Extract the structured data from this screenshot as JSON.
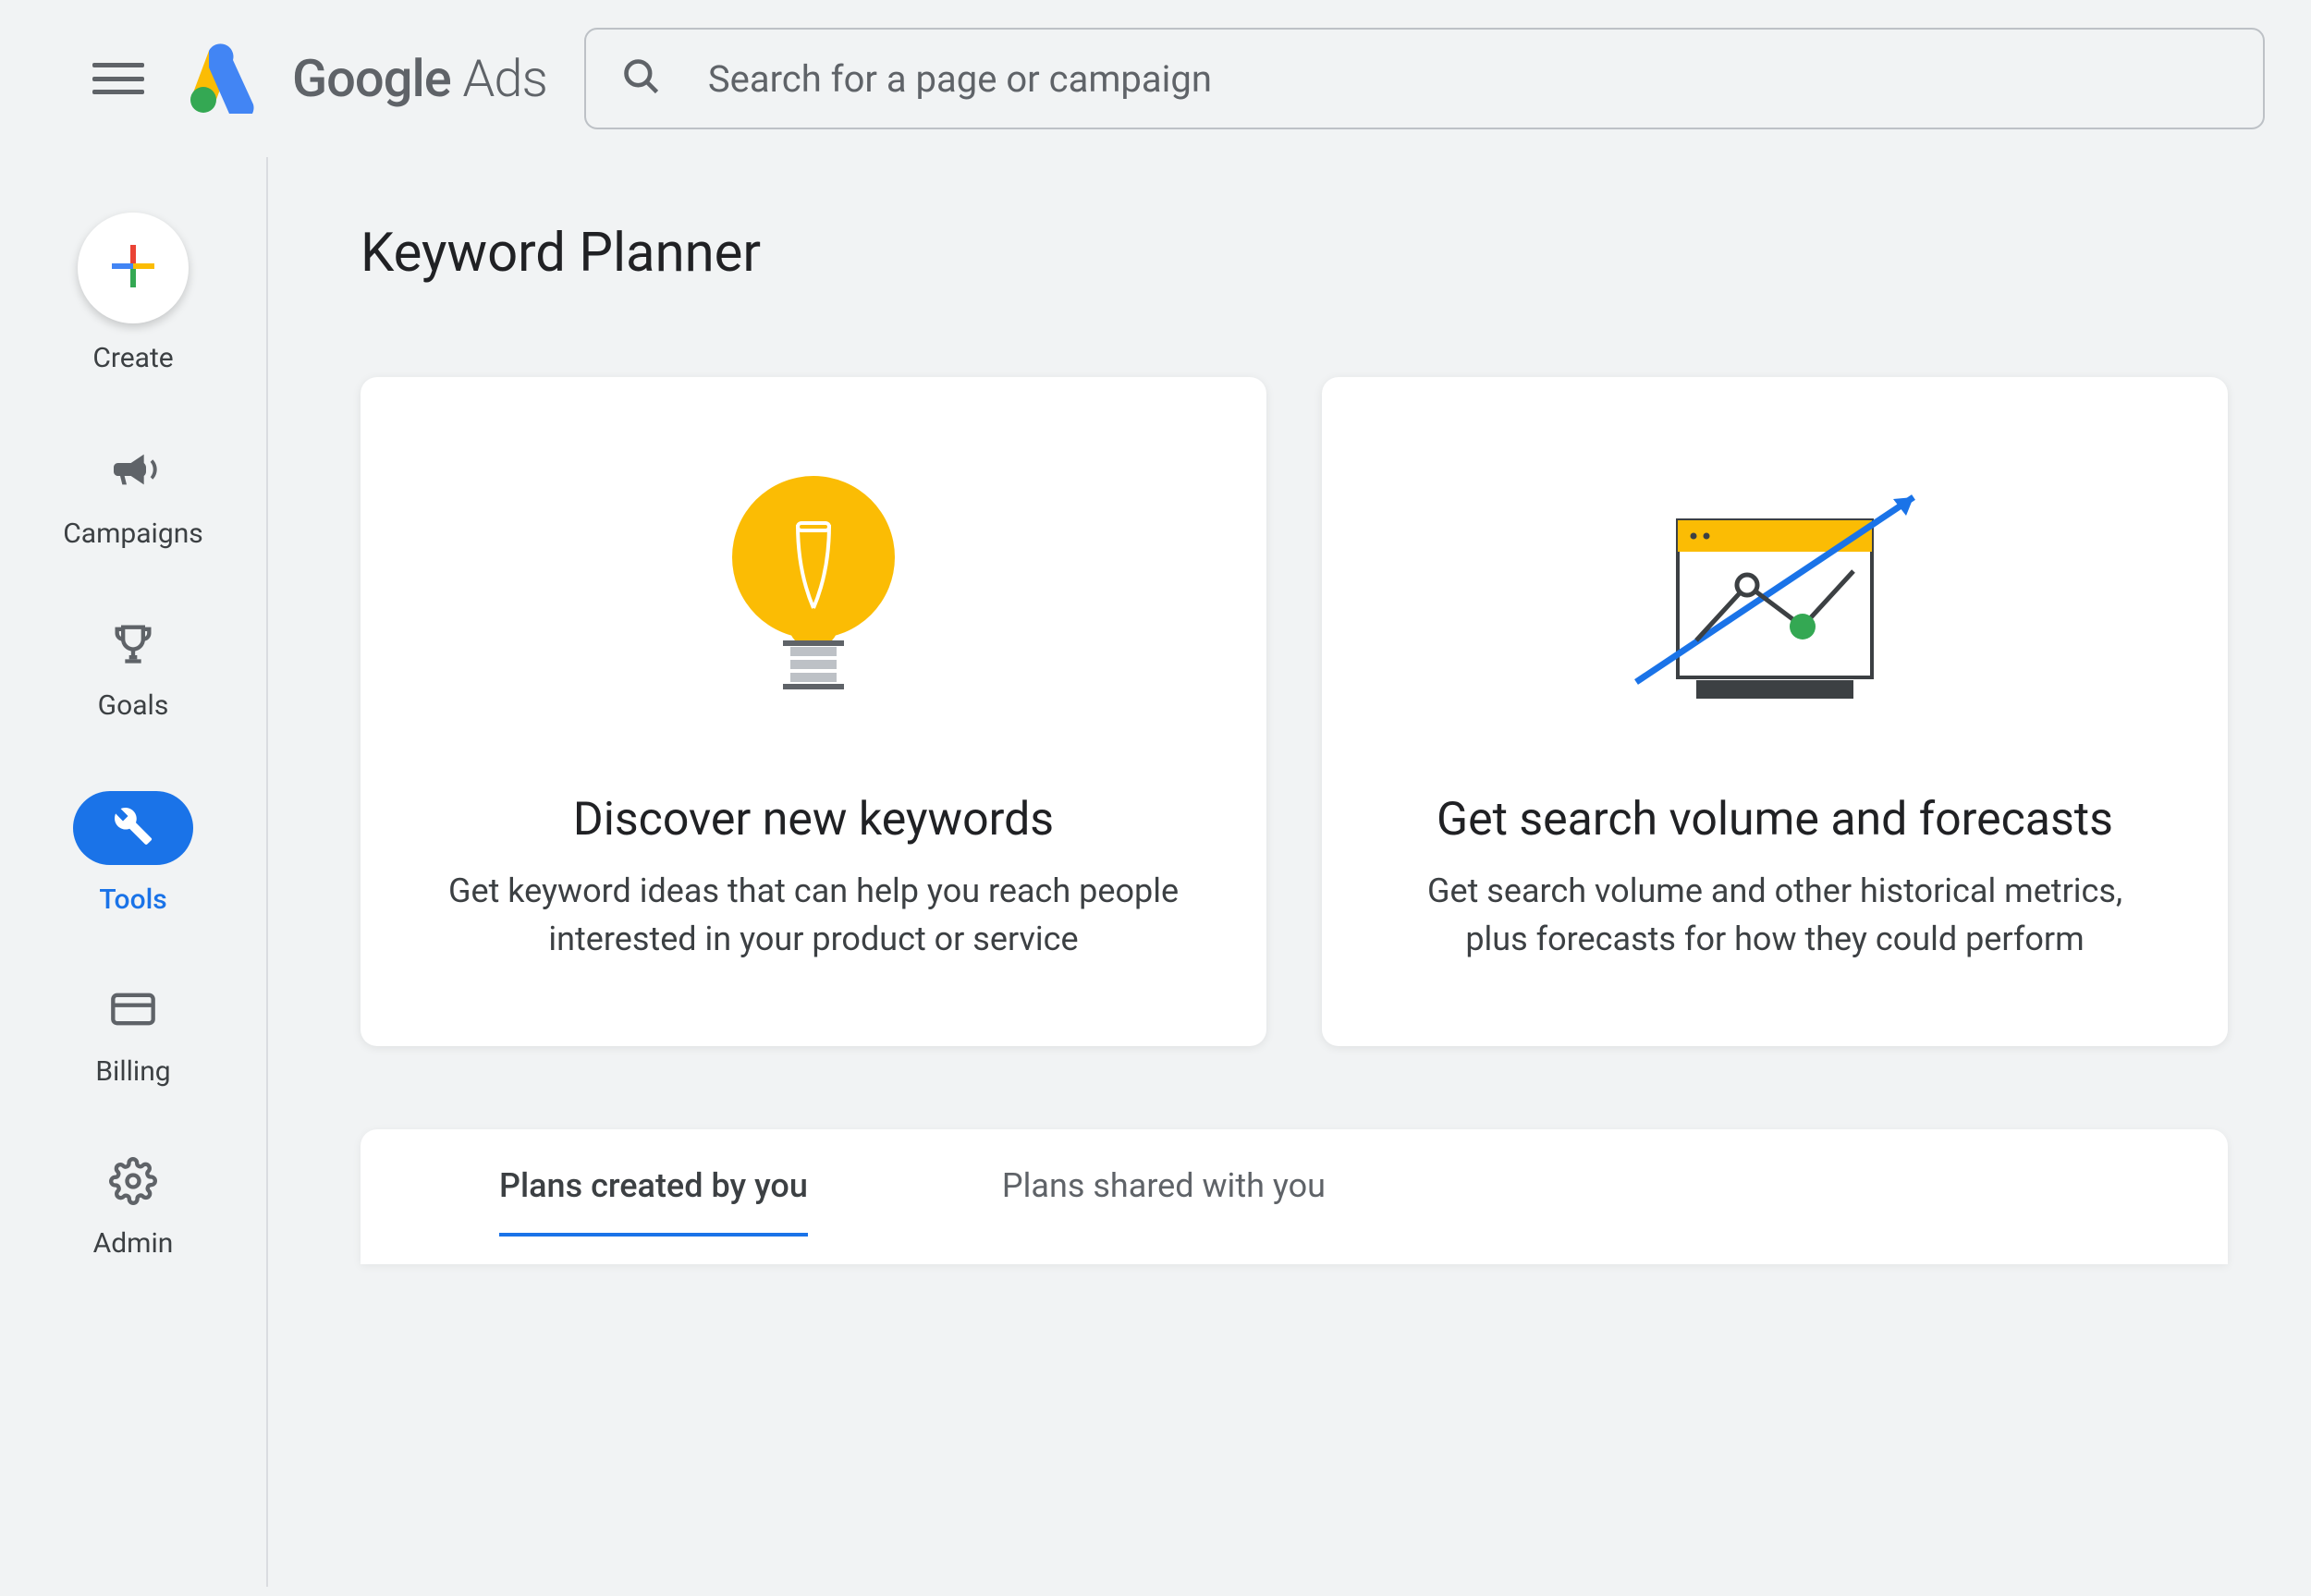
{
  "header": {
    "logo_bold": "Google",
    "logo_light": " Ads",
    "search_placeholder": "Search for a page or campaign"
  },
  "sidebar": {
    "items": [
      {
        "label": "Create",
        "icon": "plus-icon",
        "active": false
      },
      {
        "label": "Campaigns",
        "icon": "megaphone-icon",
        "active": false
      },
      {
        "label": "Goals",
        "icon": "trophy-icon",
        "active": false
      },
      {
        "label": "Tools",
        "icon": "tools-icon",
        "active": true
      },
      {
        "label": "Billing",
        "icon": "credit-card-icon",
        "active": false
      },
      {
        "label": "Admin",
        "icon": "gear-icon",
        "active": false
      }
    ]
  },
  "main": {
    "page_title": "Keyword Planner",
    "cards": [
      {
        "title": "Discover new keywords",
        "description": "Get keyword ideas that can help you reach people interested in your product or service"
      },
      {
        "title": "Get search volume and forecasts",
        "description": "Get search volume and other historical metrics, plus forecasts for how they could perform"
      }
    ],
    "tabs": [
      {
        "label": "Plans created by you",
        "active": true
      },
      {
        "label": "Plans shared with you",
        "active": false
      }
    ]
  },
  "colors": {
    "blue": "#1a73e8",
    "yellow": "#fbbc04",
    "green": "#34a853",
    "red": "#ea4335",
    "gray": "#5f6368"
  }
}
